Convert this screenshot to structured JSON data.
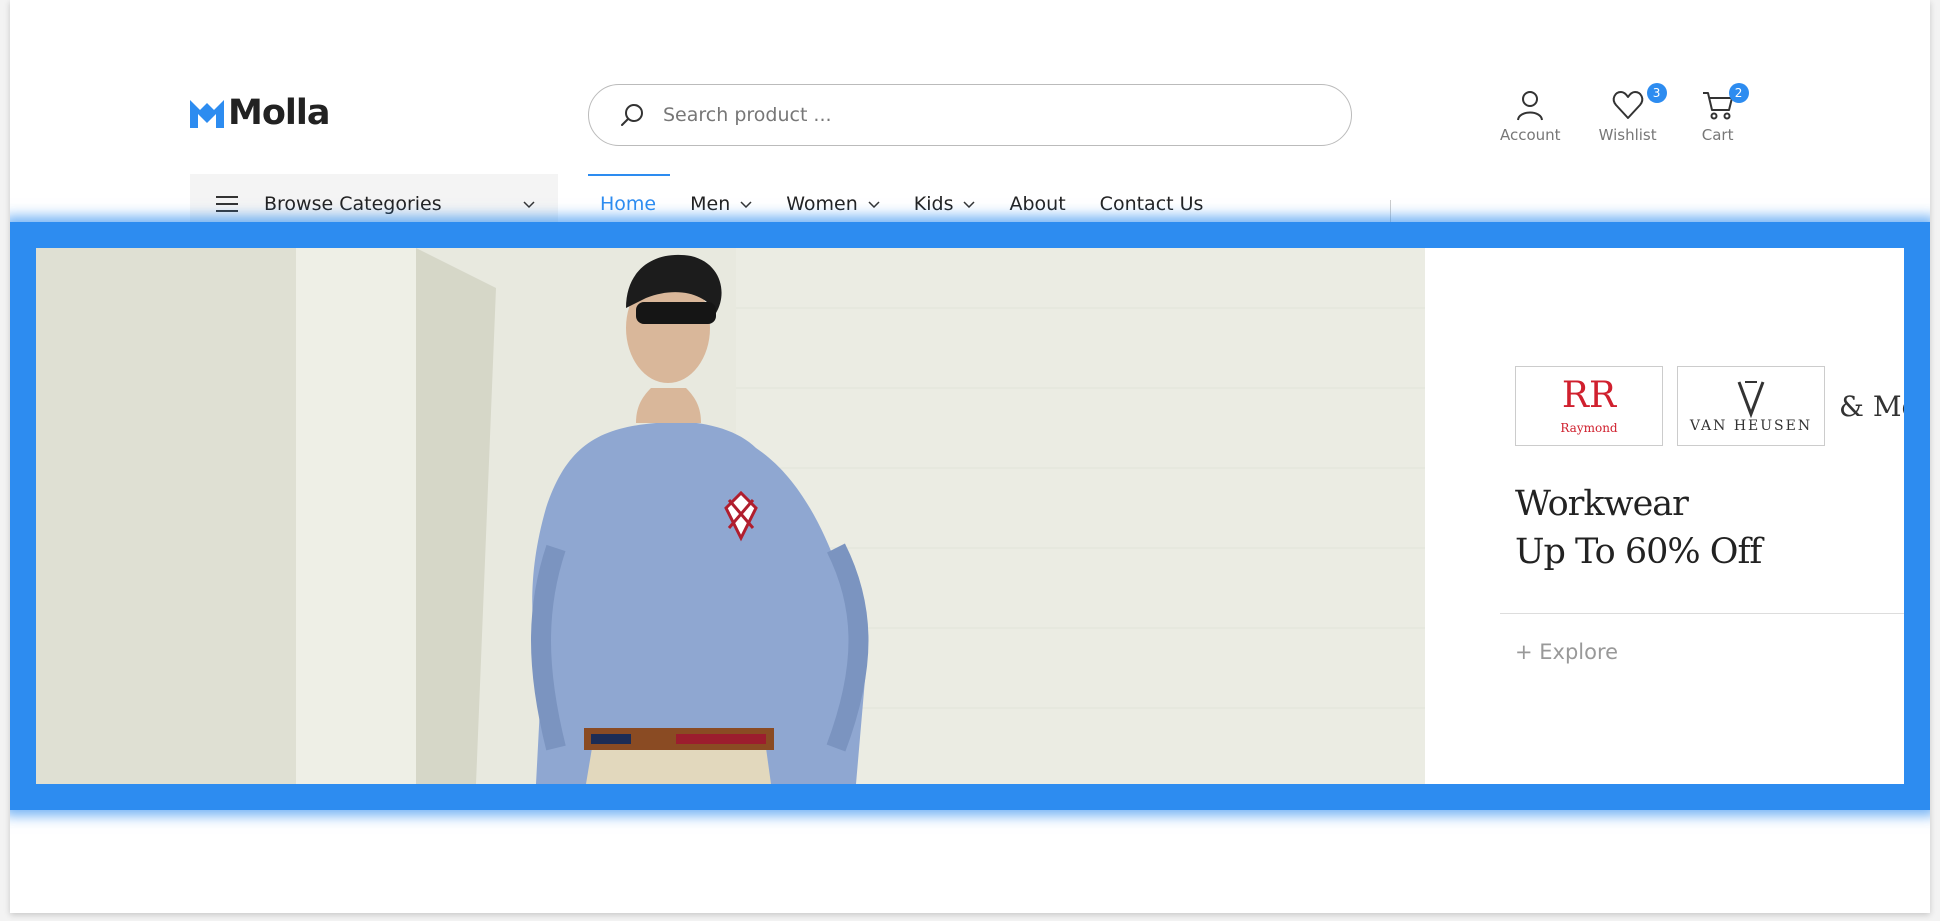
{
  "brand": {
    "name": "Molla",
    "accent": "#2d8cf0"
  },
  "search": {
    "placeholder": "Search product ..."
  },
  "header_actions": {
    "account": {
      "label": "Account"
    },
    "wishlist": {
      "label": "Wishlist",
      "count": "3"
    },
    "cart": {
      "label": "Cart",
      "count": "2"
    }
  },
  "categories": {
    "label": "Browse Categories"
  },
  "nav": {
    "items": [
      {
        "label": "Home",
        "active": true
      },
      {
        "label": "Men",
        "dropdown": true
      },
      {
        "label": "Women",
        "dropdown": true
      },
      {
        "label": "Kids",
        "dropdown": true
      },
      {
        "label": "About"
      },
      {
        "label": "Contact Us"
      }
    ]
  },
  "banner": {
    "brands": [
      "Raymond",
      "VAN HEUSEN"
    ],
    "brands_more": "& More",
    "title_line1": "Workwear",
    "title_line2": "Up To 60% Off",
    "cta": "+ Explore",
    "image_icon": "man-in-blue-shirt-photo",
    "highlight_color": "#2d8cf0"
  }
}
